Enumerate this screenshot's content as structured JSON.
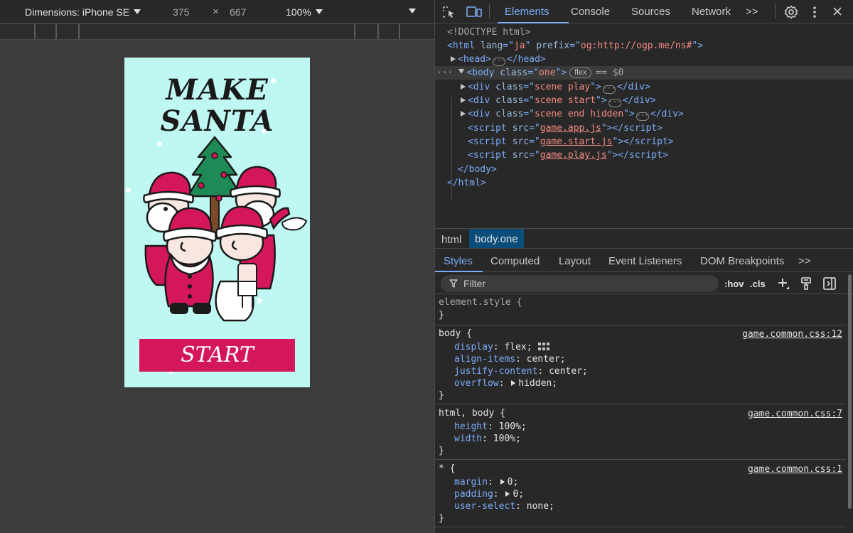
{
  "device_toolbar": {
    "dimensions_label": "Dimensions: iPhone SE",
    "width": "375",
    "times": "×",
    "height": "667",
    "zoom": "100%"
  },
  "game": {
    "title_line1": "MAKE",
    "title_line2": "SANTA",
    "start_label": "START",
    "bg_color": "#bff8f3",
    "button_color": "#d4165a"
  },
  "devtools": {
    "tabs": [
      "Elements",
      "Console",
      "Sources",
      "Network"
    ],
    "active_tab": "Elements",
    "more_tabs": ">>",
    "dom": {
      "doctype": "<!DOCTYPE html>",
      "html_lang": "ja",
      "html_prefix": "og:http://ogp.me/ns#",
      "body_class": "one",
      "body_badge": "flex",
      "body_ref": "== $0",
      "divs": [
        "scene play",
        "scene start",
        "scene end hidden"
      ],
      "scripts": [
        "game.app.js",
        "game.start.js",
        "game.play.js"
      ]
    },
    "breadcrumbs": [
      "html",
      "body.one"
    ],
    "sub_tabs": [
      "Styles",
      "Computed",
      "Layout",
      "Event Listeners",
      "DOM Breakpoints"
    ],
    "sub_more": ">>",
    "filter_placeholder": "Filter",
    "hov": ":hov",
    "cls": ".cls",
    "styles": {
      "element_style": "element.style {",
      "body_rule": {
        "selector": "body {",
        "source": "game.common.css:12",
        "props": [
          {
            "name": "display",
            "value": "flex;"
          },
          {
            "name": "align-items",
            "value": "center;"
          },
          {
            "name": "justify-content",
            "value": "center;"
          },
          {
            "name": "overflow",
            "value": "hidden;"
          }
        ]
      },
      "html_body_rule": {
        "selector": "html, body {",
        "source": "game.common.css:7",
        "props": [
          {
            "name": "height",
            "value": "100%;"
          },
          {
            "name": "width",
            "value": "100%;"
          }
        ]
      },
      "star_rule": {
        "selector": "* {",
        "source": "game.common.css:1",
        "props": [
          {
            "name": "margin",
            "value": "0;"
          },
          {
            "name": "padding",
            "value": "0;"
          },
          {
            "name": "user-select",
            "value": "none;"
          }
        ]
      },
      "close_brace": "}"
    },
    "accent_color": "#7cacf8"
  }
}
